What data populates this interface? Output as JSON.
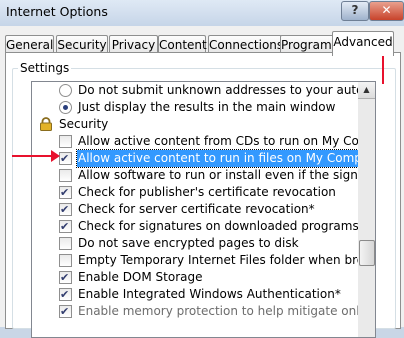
{
  "window": {
    "title": "Internet Options",
    "help_label": "?",
    "close_label": "✕"
  },
  "tabs": [
    {
      "label": "General"
    },
    {
      "label": "Security"
    },
    {
      "label": "Privacy"
    },
    {
      "label": "Content"
    },
    {
      "label": "Connections"
    },
    {
      "label": "Programs"
    },
    {
      "label": "Advanced",
      "active": true
    }
  ],
  "settings": {
    "label": "Settings",
    "items": [
      {
        "kind": "radio",
        "checked": false,
        "text": "Do not submit unknown addresses to your auto-search pr"
      },
      {
        "kind": "radio",
        "checked": true,
        "text": "Just display the results in the main window"
      },
      {
        "kind": "category",
        "icon": "lock-icon",
        "text": "Security"
      },
      {
        "kind": "checkbox",
        "checked": false,
        "text": "Allow active content from CDs to run on My Computer*"
      },
      {
        "kind": "checkbox",
        "checked": true,
        "text": "Allow active content to run in files on My Computer*",
        "highlighted": true
      },
      {
        "kind": "checkbox",
        "checked": false,
        "text": "Allow software to run or install even if the signature is inva"
      },
      {
        "kind": "checkbox",
        "checked": true,
        "text": "Check for publisher's certificate revocation"
      },
      {
        "kind": "checkbox",
        "checked": true,
        "text": "Check for server certificate revocation*"
      },
      {
        "kind": "checkbox",
        "checked": true,
        "text": "Check for signatures on downloaded programs"
      },
      {
        "kind": "checkbox",
        "checked": false,
        "text": "Do not save encrypted pages to disk"
      },
      {
        "kind": "checkbox",
        "checked": false,
        "text": "Empty Temporary Internet Files folder when browser is clo"
      },
      {
        "kind": "checkbox",
        "checked": true,
        "text": "Enable DOM Storage"
      },
      {
        "kind": "checkbox",
        "checked": true,
        "text": "Enable Integrated Windows Authentication*"
      },
      {
        "kind": "checkbox",
        "checked": true,
        "text": "Enable memory protection to help mitigate online attacks*",
        "disabled": true
      }
    ]
  },
  "colors": {
    "annotation_arrow": "#e8112d",
    "highlight": "#3399ff"
  }
}
